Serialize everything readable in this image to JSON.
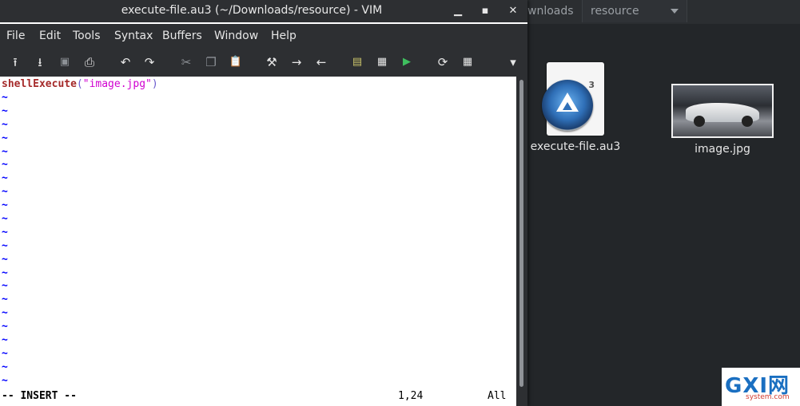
{
  "window": {
    "title": "execute-file.au3 (~/Downloads/resource) - VIM",
    "minimize_icon": "minimize-icon",
    "maximize_icon": "maximize-icon",
    "close_icon": "close-icon"
  },
  "menu": [
    "File",
    "Edit",
    "Tools",
    "Syntax",
    "Buffers",
    "Window",
    "Help"
  ],
  "toolbar": [
    {
      "icon": "open-icon",
      "glyph": "⭱"
    },
    {
      "icon": "save-download-icon",
      "glyph": "⭳"
    },
    {
      "icon": "save-icon",
      "glyph": "▣"
    },
    {
      "icon": "print-icon",
      "glyph": "⎙"
    },
    {
      "icon": "undo-icon",
      "glyph": "↶"
    },
    {
      "icon": "redo-icon",
      "glyph": "↷"
    },
    {
      "icon": "cut-icon",
      "glyph": "✂"
    },
    {
      "icon": "copy-icon",
      "glyph": "❐"
    },
    {
      "icon": "paste-icon",
      "glyph": "📋"
    },
    {
      "icon": "replace-icon",
      "glyph": "⚒"
    },
    {
      "icon": "find-next-icon",
      "glyph": "→"
    },
    {
      "icon": "find-prev-icon",
      "glyph": "←"
    },
    {
      "icon": "load-session-icon",
      "glyph": "▤"
    },
    {
      "icon": "save-session-icon",
      "glyph": "▦"
    },
    {
      "icon": "run-script-icon",
      "glyph": "▶"
    },
    {
      "icon": "make-icon",
      "glyph": "⟳"
    },
    {
      "icon": "tags-icon",
      "glyph": "▦"
    },
    {
      "icon": "more-icon",
      "glyph": "▾"
    }
  ],
  "editor": {
    "code": {
      "function": "shellExecute",
      "open_paren": "(",
      "string": "\"image.jpg\"",
      "close_paren": ")"
    },
    "tilde": "~",
    "tilde_count": 22,
    "status": {
      "mode": "-- INSERT --",
      "position": "1,24",
      "scroll": "All"
    }
  },
  "file_manager": {
    "tabs": [
      "wnloads",
      "resource"
    ],
    "files": [
      {
        "name": "execute-file.au3",
        "icon": "autoit-file-icon"
      },
      {
        "name": "image.jpg",
        "icon": "image-thumbnail"
      }
    ]
  },
  "watermark": {
    "logo": "GXI网",
    "sub": "system.com"
  }
}
